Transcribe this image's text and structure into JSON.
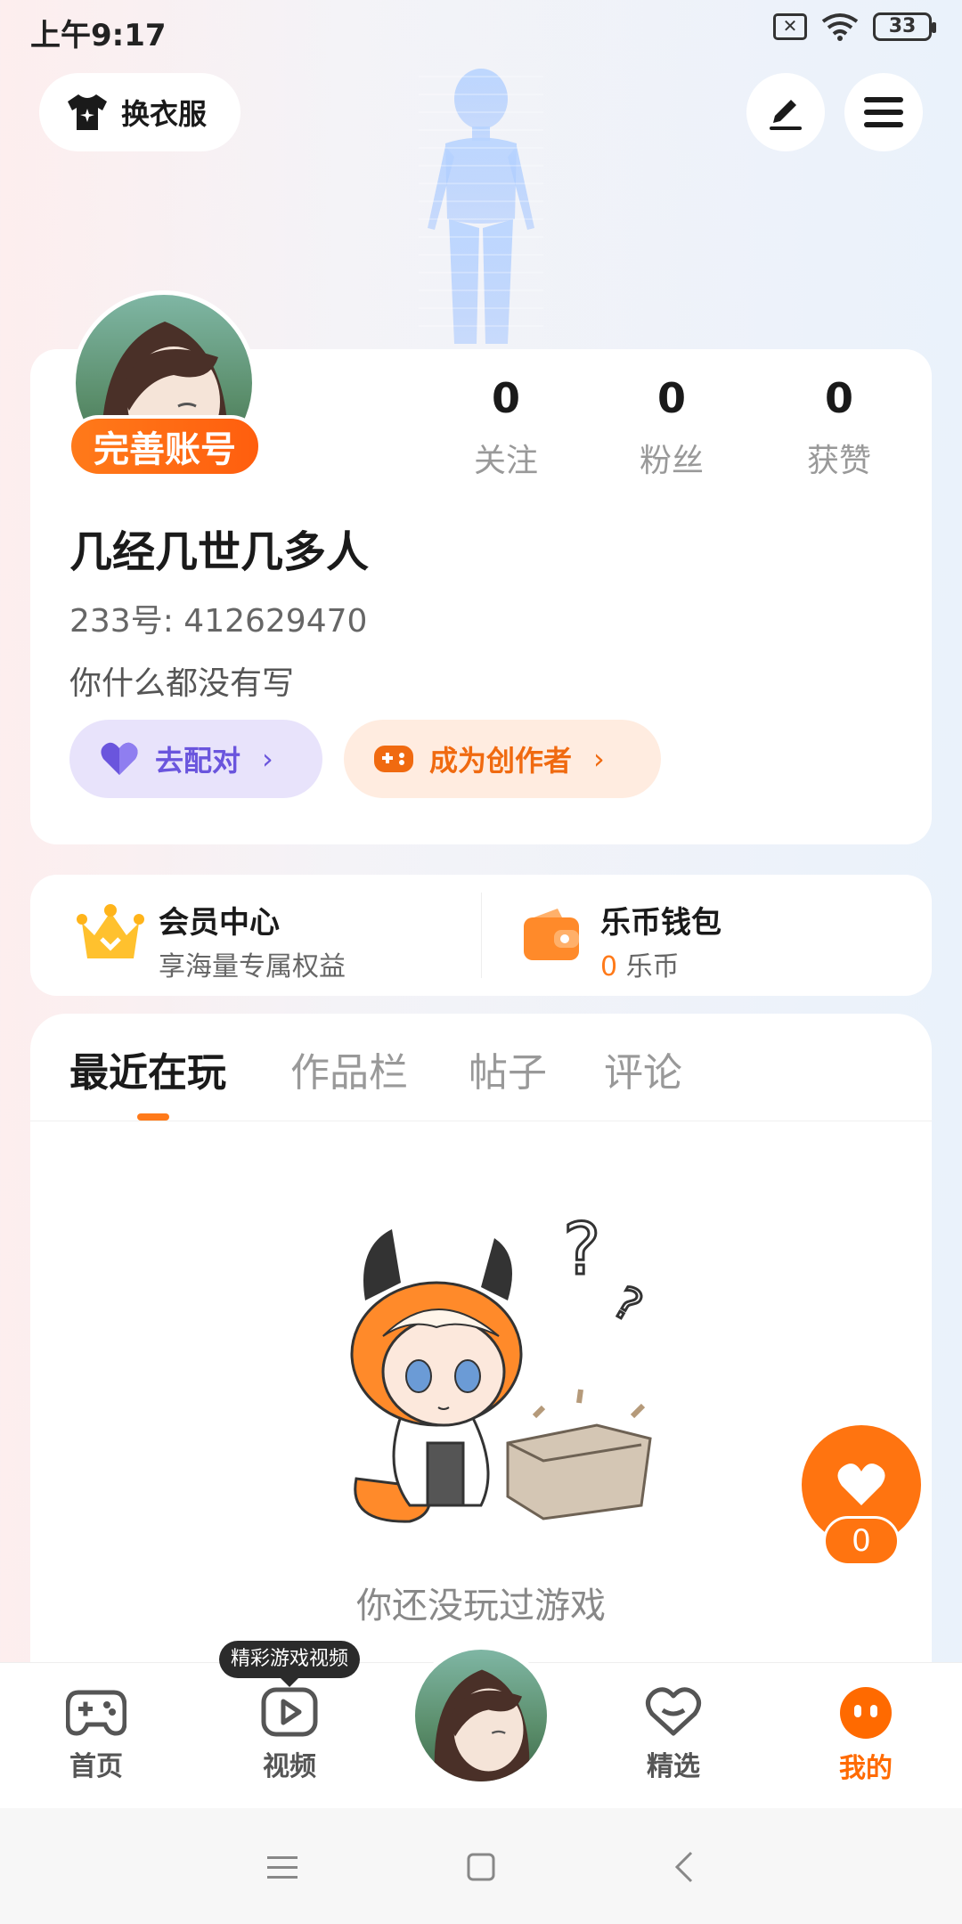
{
  "status_bar": {
    "time": "上午9:17",
    "battery": "33"
  },
  "header": {
    "outfit_label": "换衣服"
  },
  "profile": {
    "badge": "完善账号",
    "stats": [
      {
        "value": "0",
        "label": "关注"
      },
      {
        "value": "0",
        "label": "粉丝"
      },
      {
        "value": "0",
        "label": "获赞"
      }
    ],
    "username": "几经几世几多人",
    "uid": "233号: 412629470",
    "bio": "你什么都没有写",
    "match_label": "去配对",
    "creator_label": "成为创作者"
  },
  "member": {
    "title": "会员中心",
    "subtitle": "享海量专属权益",
    "wallet_title": "乐币钱包",
    "wallet_amount": "0",
    "wallet_unit": "乐币"
  },
  "tabs": [
    {
      "label": "最近在玩"
    },
    {
      "label": "作品栏"
    },
    {
      "label": "帖子"
    },
    {
      "label": "评论"
    }
  ],
  "empty_state": {
    "text": "你还没玩过游戏"
  },
  "like_fab": {
    "count": "0"
  },
  "bottom_nav": {
    "video_tip": "精彩游戏视频",
    "items": [
      {
        "label": "首页"
      },
      {
        "label": "视频"
      },
      {
        "label": "精选"
      },
      {
        "label": "我的"
      }
    ]
  },
  "colors": {
    "accent": "#ff7410",
    "match": "#6a55dd",
    "creator": "#f06a10"
  }
}
